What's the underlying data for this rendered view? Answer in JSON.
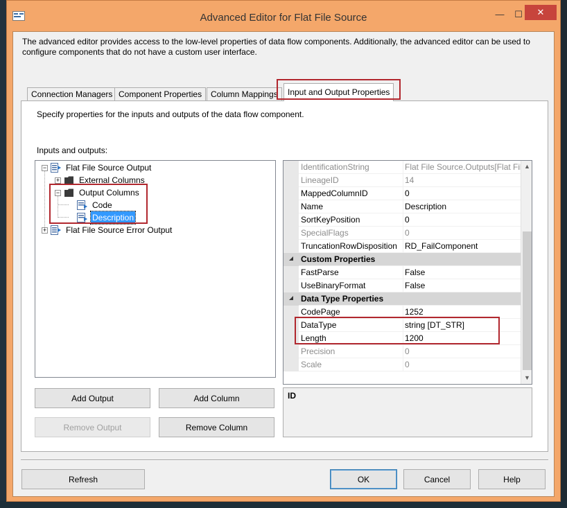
{
  "window": {
    "title": "Advanced Editor for Flat File Source",
    "minimize_glyph": "—",
    "maximize_glyph": "☐",
    "close_glyph": "✕"
  },
  "intro_text": "The advanced editor provides access to the low-level properties of data flow components. Additionally, the advanced editor can be used to configure components that do not have a custom user interface.",
  "tabs": [
    {
      "label": "Connection Managers",
      "active": false
    },
    {
      "label": "Component Properties",
      "active": false
    },
    {
      "label": "Column Mappings",
      "active": false
    },
    {
      "label": "Input and Output Properties",
      "active": true
    }
  ],
  "panel": {
    "description": "Specify properties for the inputs and outputs of the data flow component.",
    "io_label": "Inputs and outputs:"
  },
  "tree": [
    {
      "label": "Flat File Source Output",
      "expanded": true,
      "icon": "output-icon"
    },
    {
      "label": "External Columns",
      "expanded": false,
      "icon": "folder-icon"
    },
    {
      "label": "Output Columns",
      "expanded": true,
      "icon": "folder-icon"
    },
    {
      "label": "Code",
      "icon": "column-icon"
    },
    {
      "label": "Description",
      "icon": "column-icon",
      "selected": true
    },
    {
      "label": "Flat File Source Error Output",
      "expanded": false,
      "icon": "output-icon"
    }
  ],
  "properties": [
    {
      "name": "IdentificationString",
      "value": "Flat File Source.Outputs[Flat File",
      "disabled": true
    },
    {
      "name": "LineageID",
      "value": "14",
      "disabled": true
    },
    {
      "name": "MappedColumnID",
      "value": "0"
    },
    {
      "name": "Name",
      "value": "Description"
    },
    {
      "name": "SortKeyPosition",
      "value": "0"
    },
    {
      "name": "SpecialFlags",
      "value": "0",
      "disabled": true
    },
    {
      "name": "TruncationRowDisposition",
      "value": "RD_FailComponent"
    },
    {
      "category": "Custom Properties"
    },
    {
      "name": "FastParse",
      "value": "False"
    },
    {
      "name": "UseBinaryFormat",
      "value": "False"
    },
    {
      "category": "Data Type Properties"
    },
    {
      "name": "CodePage",
      "value": "1252"
    },
    {
      "name": "DataType",
      "value": "string [DT_STR]"
    },
    {
      "name": "Length",
      "value": "1200"
    },
    {
      "name": "Precision",
      "value": "0",
      "disabled": true
    },
    {
      "name": "Scale",
      "value": "0",
      "disabled": true
    }
  ],
  "description_box": {
    "title": "ID"
  },
  "buttons": {
    "add_output": "Add Output",
    "add_column": "Add Column",
    "remove_output": "Remove Output",
    "remove_column": "Remove Column",
    "refresh": "Refresh",
    "ok": "OK",
    "cancel": "Cancel",
    "help": "Help"
  },
  "colors": {
    "window_frame": "#f4a76a",
    "close_button": "#c7443c",
    "selection": "#3399ff",
    "highlight_annotation": "#b1272e",
    "category_row": "#d6d6d6"
  }
}
